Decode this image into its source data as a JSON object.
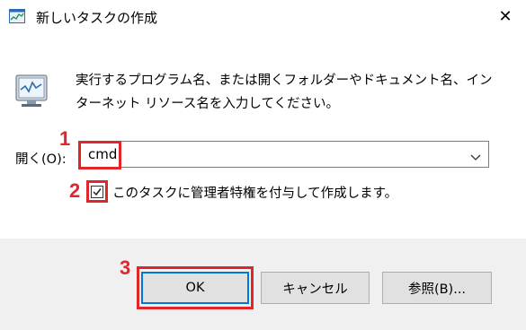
{
  "window": {
    "title": "新しいタスクの作成",
    "close_glyph": "✕"
  },
  "description": "実行するプログラム名、または開くフォルダーやドキュメント名、インターネット リソース名を入力してください。",
  "open_field": {
    "label": "開く(O):",
    "value": "cmd"
  },
  "admin_checkbox": {
    "checked": true,
    "label": "このタスクに管理者特権を付与して作成します。"
  },
  "buttons": {
    "ok": "OK",
    "cancel": "キャンセル",
    "browse": "参照(B)..."
  },
  "annotations": {
    "step1": "1",
    "step2": "2",
    "step3": "3",
    "color": "#e0262a"
  },
  "colors": {
    "accent": "#0078d7",
    "footer_bg": "#f0f0f0"
  }
}
